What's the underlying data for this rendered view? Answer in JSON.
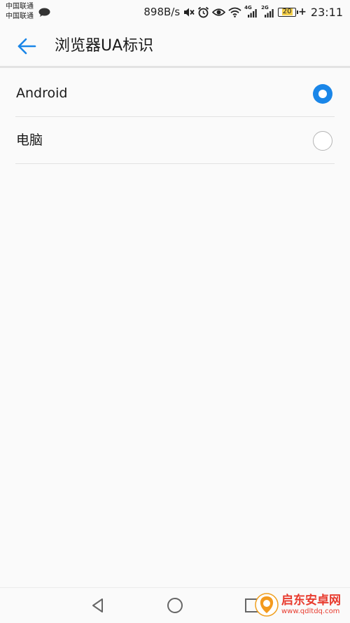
{
  "status_bar": {
    "carrier_1": "中国联通",
    "carrier_2": "中国联通",
    "net_speed": "898B/s",
    "signal_1_label": "4G",
    "signal_2_label": "2G",
    "battery": "20",
    "charging": "+",
    "time": "23:11"
  },
  "toolbar": {
    "title": "浏览器UA标识"
  },
  "options": [
    {
      "label": "Android",
      "checked": true
    },
    {
      "label": "电脑",
      "checked": false
    }
  ],
  "watermark": {
    "name": "启东安卓网",
    "url": "www.qdltdq.com"
  },
  "colors": {
    "accent": "#1a86e8",
    "background": "#fafafa",
    "divider": "#e2e2e2",
    "watermark": "#e83b2e"
  }
}
